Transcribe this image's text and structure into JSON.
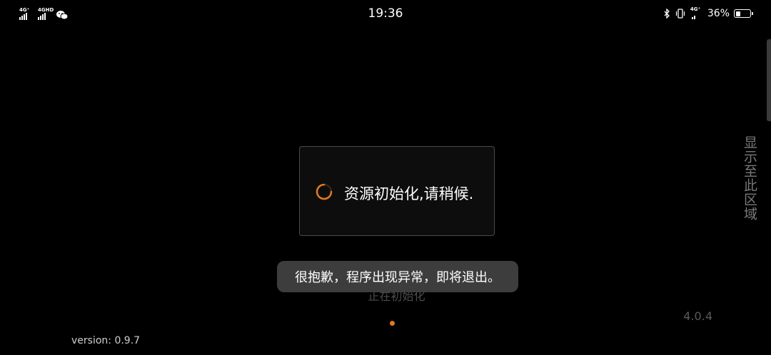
{
  "status_bar": {
    "network1": "4G⁺",
    "network2": "4GHD",
    "time": "19:36",
    "network3": "4G⁺",
    "battery_percent": "36%",
    "battery_level": 0.36,
    "icons": [
      "signal-icon",
      "signal-icon",
      "wechat-icon",
      "bluetooth-icon",
      "vibrate-icon",
      "signal-icon",
      "battery-icon"
    ]
  },
  "side_hint": "显示至此区域",
  "loading": {
    "message": "资源初始化,请稍候.",
    "accent_color": "#e07a1f"
  },
  "init_status": "正在初始化",
  "toast": {
    "message": "很抱歉，程序出现异常，即将退出。"
  },
  "app_version": "4.0.4",
  "engine_version": "version: 0.9.7"
}
